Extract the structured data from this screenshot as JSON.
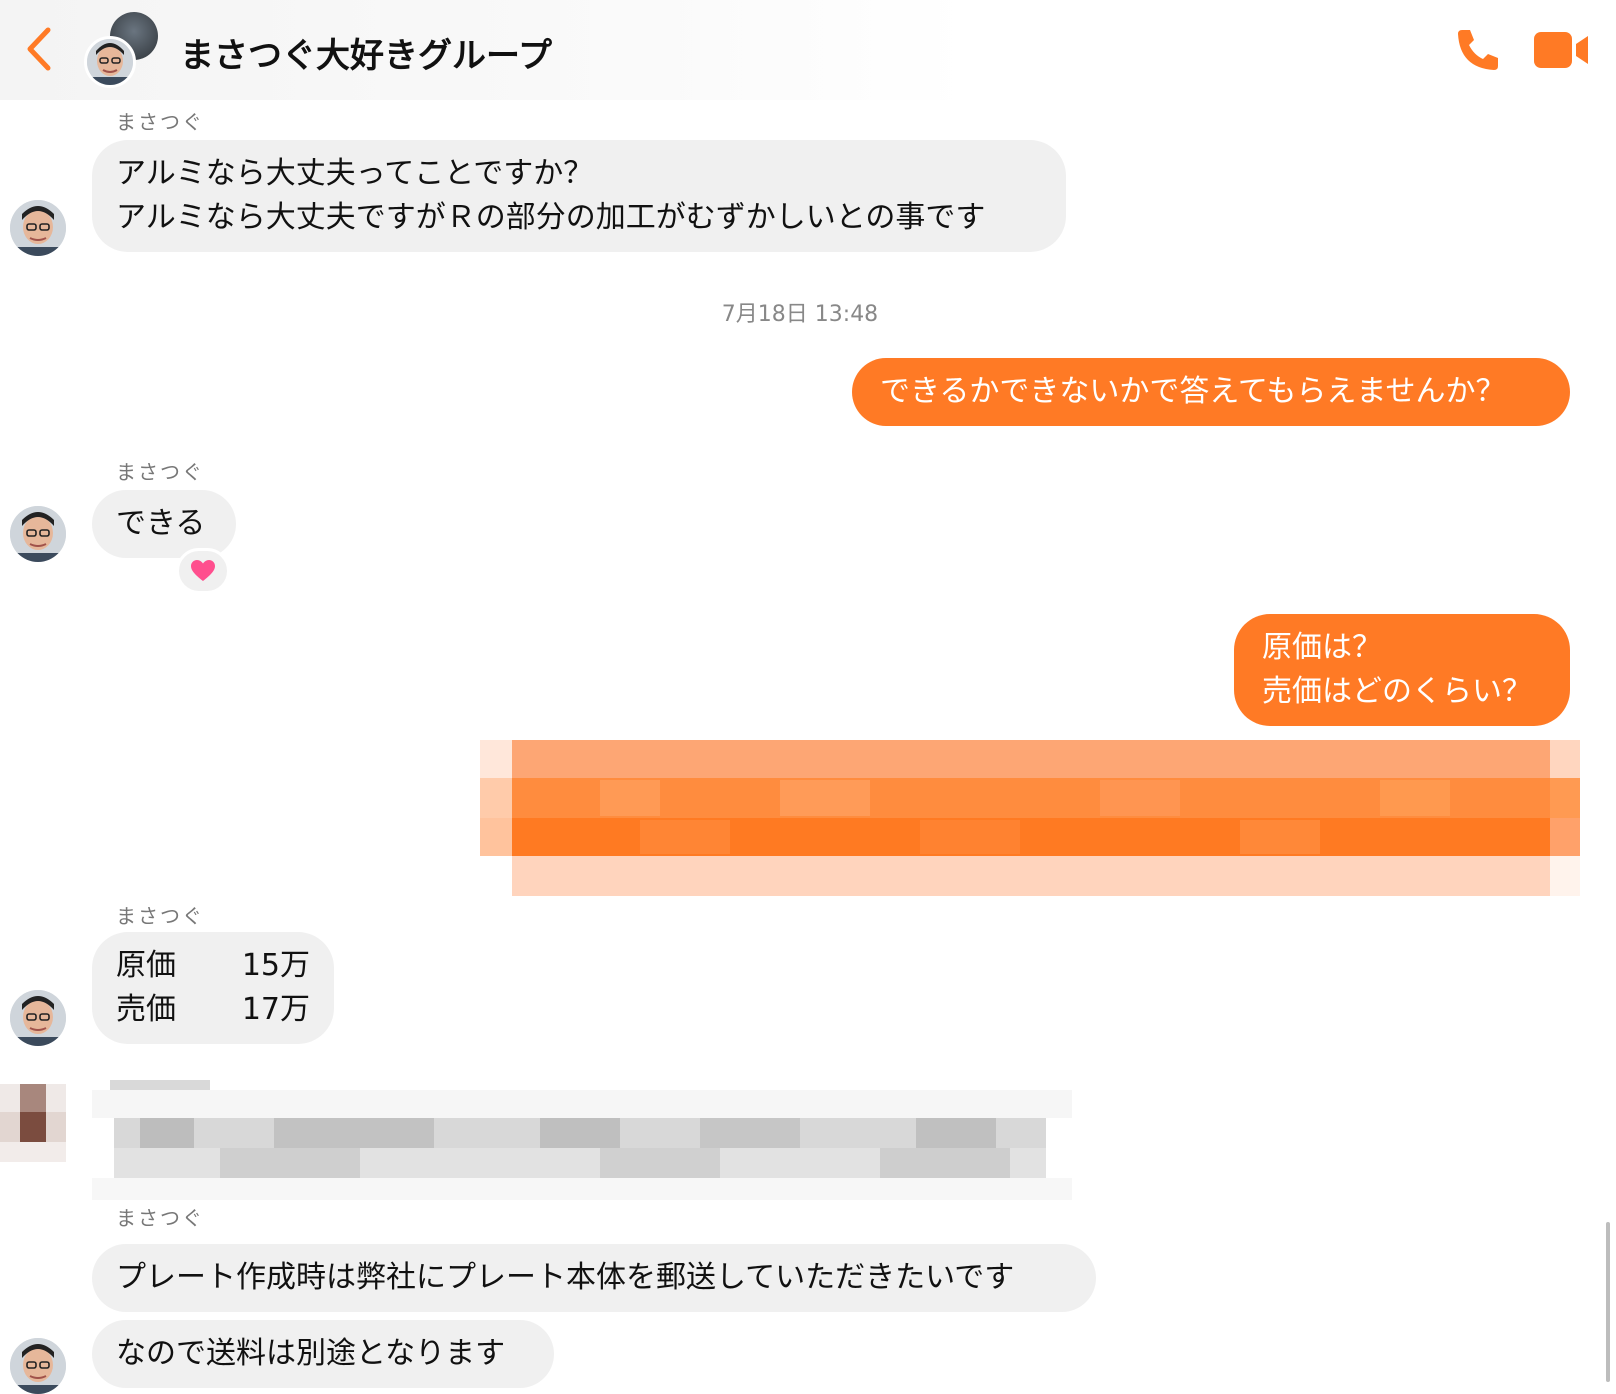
{
  "header": {
    "title": "まさつぐ大好きグループ",
    "back_icon": "chevron-left-icon",
    "call_icon": "phone-icon",
    "video_icon": "video-camera-icon",
    "accent_color": "#ff7a25"
  },
  "messages": [
    {
      "sender": "まさつぐ",
      "direction": "incoming",
      "lines": [
        "アルミなら大丈夫ってことですか？",
        "アルミなら大丈夫ですがＲの部分の加工がむずかしいとの事です"
      ]
    },
    {
      "timestamp": "7月18日 13:48"
    },
    {
      "direction": "outgoing",
      "text": "できるかできないかで答えてもらえませんか？"
    },
    {
      "sender": "まさつぐ",
      "direction": "incoming",
      "text": "できる",
      "reaction": "heart-icon"
    },
    {
      "direction": "outgoing",
      "lines": [
        "原価は？",
        "売価はどのくらい？"
      ]
    },
    {
      "direction": "outgoing",
      "redacted": true
    },
    {
      "sender": "まさつぐ",
      "direction": "incoming",
      "rows": [
        {
          "label": "原価",
          "value": "15万"
        },
        {
          "label": "売価",
          "value": "17万"
        }
      ]
    },
    {
      "sender": "まさつぐ",
      "direction": "incoming",
      "redacted": true
    },
    {
      "sender": "まさつぐ",
      "direction": "incoming",
      "text": "プレート作成時は弊社にプレート本体を郵送していただきたいです"
    },
    {
      "direction": "incoming",
      "text": "なので送料は別途となります"
    }
  ]
}
